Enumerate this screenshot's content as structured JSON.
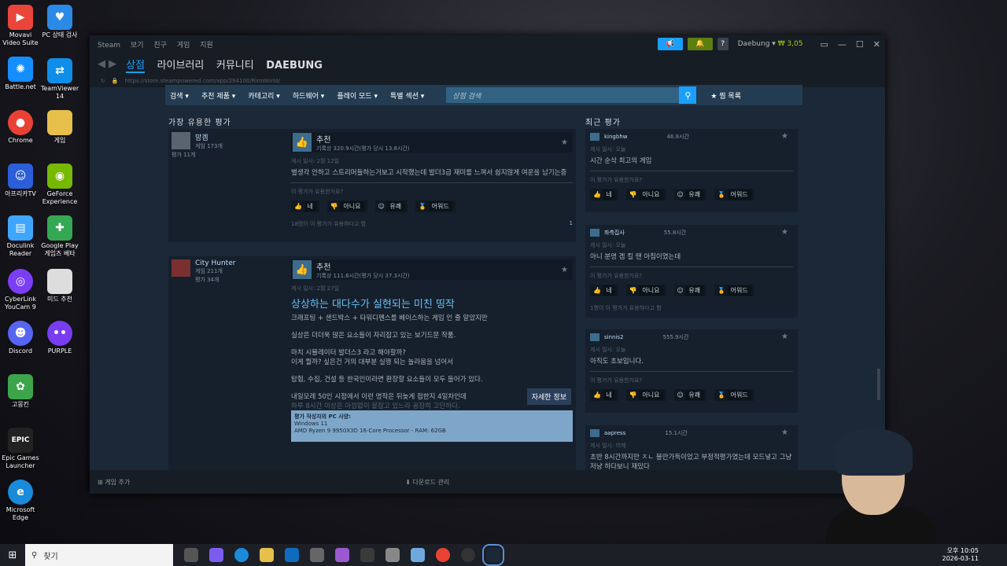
{
  "desktop_icons": [
    {
      "label": "Movavi Video Suite",
      "color": "#e9453a"
    },
    {
      "label": "PC 상태 검사",
      "color": "#2b8ae6"
    },
    {
      "label": "Battle.net",
      "color": "#148eff"
    },
    {
      "label": "TeamViewer 14",
      "color": "#0e8ee9"
    },
    {
      "label": "Chrome",
      "color": "#e94235"
    },
    {
      "label": "게임",
      "color": "#e6c04a"
    },
    {
      "label": "아프리카TV",
      "color": "#2b5ed8"
    },
    {
      "label": "GeForce Experience",
      "color": "#76b900"
    },
    {
      "label": "Doculink Reader",
      "color": "#3ea6ff"
    },
    {
      "label": "Google Play 게임즈 베타",
      "color": "#34a853"
    },
    {
      "label": "CyberLink YouCam 9",
      "color": "#7b3ef5"
    },
    {
      "label": "미드 추천",
      "color": "#dddddd"
    },
    {
      "label": "Discord",
      "color": "#5865f2"
    },
    {
      "label": "PURPLE",
      "color": "#7a3cf0"
    },
    {
      "label": "고몽킨",
      "color": "#3ca54a"
    },
    {
      "label": "Epic Games Launcher",
      "color": "#222222"
    },
    {
      "label": "Microsoft Edge",
      "color": "#1a8adb"
    }
  ],
  "titlebar": {
    "menu": [
      "Steam",
      "보기",
      "친구",
      "게임",
      "지원"
    ],
    "help": "?",
    "account_name": "Daebung",
    "balance": "₩ 3,05"
  },
  "nav": {
    "tabs": [
      "상점",
      "라이브러리",
      "커뮤니티",
      "DAEBUNG"
    ],
    "url": "https://store.steampowered.com/app/294100/RimWorld/"
  },
  "store_nav": {
    "items": [
      "검색 ▾",
      "추천 제품 ▾",
      "카테고리 ▾",
      "하드웨어 ▾",
      "플레이 모드 ▾",
      "특별 섹션 ▾"
    ],
    "search_placeholder": "상점 검색",
    "wishlist": "찜 목록"
  },
  "sections": {
    "helpful": "가장 유용한 평가",
    "recent": "최근 평가"
  },
  "helpful_reviews": [
    {
      "author": "망겜",
      "games": "게임 173개",
      "reviews": "평가 11개",
      "verdict": "추천",
      "hours": "기록상 320.9시간(평가 당시 13.8시간)",
      "posted": "게시 일시: 2월 12일",
      "text": "별생각 안하고 스트리머들하는거보고 시작했는데 발더3급 재미를 느껴서 쉽지않게 여운을 남기는중",
      "question": "이 평가가 유용한가요?",
      "votes": [
        "네",
        "아니요",
        "유쾌",
        "어워드"
      ],
      "count": "18명이 이 평가가 유용하다고 함",
      "comments": "1"
    },
    {
      "author": "City Hunter",
      "games": "게임 211개",
      "reviews": "평가 34개",
      "verdict": "추천",
      "hours": "기록상 111.6시간(평가 당시 37.3시간)",
      "posted": "게시 일시: 2월 27일",
      "title": "상상하는 대다수가 실현되는 미친 띵작",
      "lines": [
        "크래프팅 + 샌드박스 + 타워디펜스를 베이스하는 게임 인 줄 알았지만",
        "실상은 더더욱 많은 요소들이 자리잡고 있는 보기드문 작품.",
        "마치 시뮬레이터 발더스3 라고 해야할까?",
        "이게 뭘까? 싶은건 거의 대부분 실행 되는 놀라움을 넘어서",
        "탐험, 수집, 건설 등 한국인이라면 환장할 요소들이 모두 들어가 있다.",
        "내일모레 50인 시점에서 이런 명작은 뒤늦게 접한지 4일차인데",
        "하루 8시간 이상은 아낌없이 붙잡고 있느라 굉장히 고단하다."
      ],
      "readmore": "자세한 정보",
      "pc_title": "평가 작성자의 PC 사양:",
      "pc_lines": [
        "Windows 11",
        "AMD Ryzen 9 9950X3D 16-Core Processor - RAM: 62GB"
      ]
    }
  ],
  "recent_reviews": [
    {
      "author": "kingbhw",
      "hours": "46.8시간",
      "posted": "게시 일시: 오늘",
      "text": "시간 순삭 최고의 게임",
      "question": "이 평가가 유용한가요?",
      "votes": [
        "네",
        "아니요",
        "유쾌",
        "어워드"
      ],
      "count": ""
    },
    {
      "author": "좌측집사",
      "hours": "55.8시간",
      "posted": "게시 일시: 오늘",
      "text": "아니 분명 겜 킬 땐 아침이였는데",
      "question": "이 평가가 유용한가요?",
      "votes": [
        "네",
        "아니요",
        "유쾌",
        "어워드"
      ],
      "count": "1명이 이 평가가 유용하다고 함"
    },
    {
      "author": "sinnis2",
      "hours": "555.9시간",
      "posted": "게시 일시: 오늘",
      "text": "아직도 초보입니다.",
      "question": "이 평가가 유용한가요?",
      "votes": [
        "네",
        "아니요",
        "유쾌",
        "어워드"
      ],
      "count": ""
    },
    {
      "author": "aapress",
      "hours": "15.1시간",
      "posted": "게시 일시: 어제",
      "text": "초반 8시간까지만 ㅈㄴ 불만가득이었고 부정적평가였는데 모드넣고 그냥저냥 하다보니 재밌다",
      "question": "",
      "votes": [],
      "count": ""
    }
  ],
  "bottombar": {
    "add_game": "게임 추가",
    "downloads": "다운로드 관리"
  },
  "taskbar": {
    "search": "찾기",
    "time": "오후 10:05",
    "date": "2026-03-11"
  },
  "colors": {
    "steam_bg": "#1b2838",
    "accent": "#1a9fff",
    "link": "#66c0f4"
  }
}
